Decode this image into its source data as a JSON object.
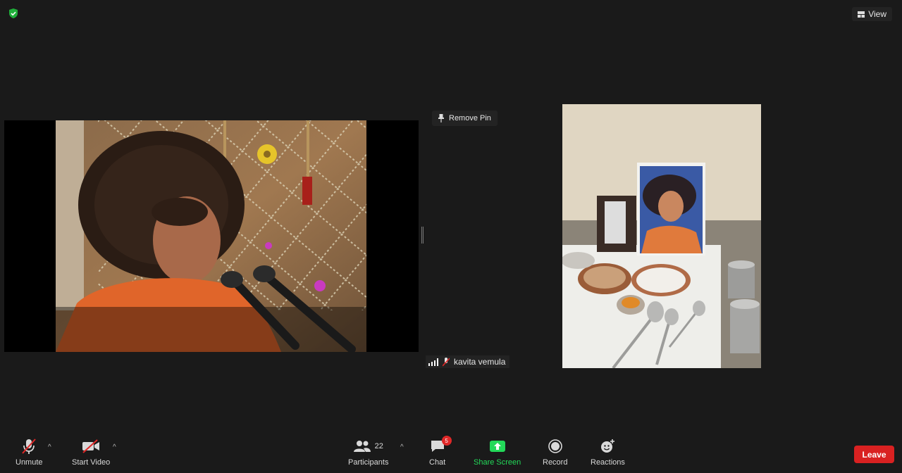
{
  "top": {
    "view_label": "View",
    "security_icon": "shield-check-icon"
  },
  "videos": {
    "pin_label": "Remove Pin",
    "participant_name": "kavita vemula"
  },
  "toolbar": {
    "unmute": "Unmute",
    "start_video": "Start Video",
    "participants": "Participants",
    "participants_count": "22",
    "chat": "Chat",
    "chat_badge": "5",
    "share_screen": "Share Screen",
    "record": "Record",
    "reactions": "Reactions",
    "leave": "Leave"
  },
  "colors": {
    "background": "#1a1a1a",
    "share_green": "#23d959",
    "leave_red": "#d92121"
  }
}
